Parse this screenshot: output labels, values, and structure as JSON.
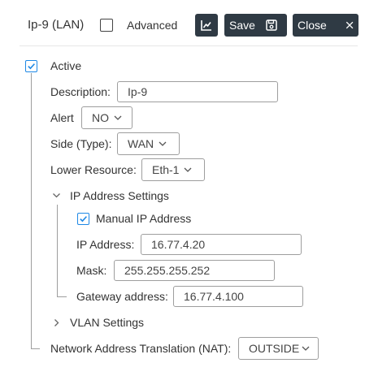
{
  "header": {
    "title": "Ip-9 (LAN)",
    "advanced_label": "Advanced",
    "save_label": "Save",
    "close_label": "Close"
  },
  "form": {
    "active_label": "Active",
    "description_label": "Description:",
    "description_value": "Ip-9",
    "alert_label": "Alert",
    "alert_value": "NO",
    "side_label": "Side (Type):",
    "side_value": "WAN",
    "lower_resource_label": "Lower Resource:",
    "lower_resource_value": "Eth-1",
    "ip_settings_label": "IP Address Settings",
    "manual_ip_label": "Manual IP Address",
    "ip_address_label": "IP Address:",
    "ip_address_value": "16.77.4.20",
    "mask_label": "Mask:",
    "mask_value": "255.255.255.252",
    "gateway_label": "Gateway address:",
    "gateway_value": "16.77.4.100",
    "vlan_settings_label": "VLAN Settings",
    "nat_label": "Network Address Translation (NAT):",
    "nat_value": "OUTSIDE"
  },
  "colors": {
    "toolbar_button_bg": "#2f3a44",
    "checkbox_accent": "#1e88e5"
  }
}
